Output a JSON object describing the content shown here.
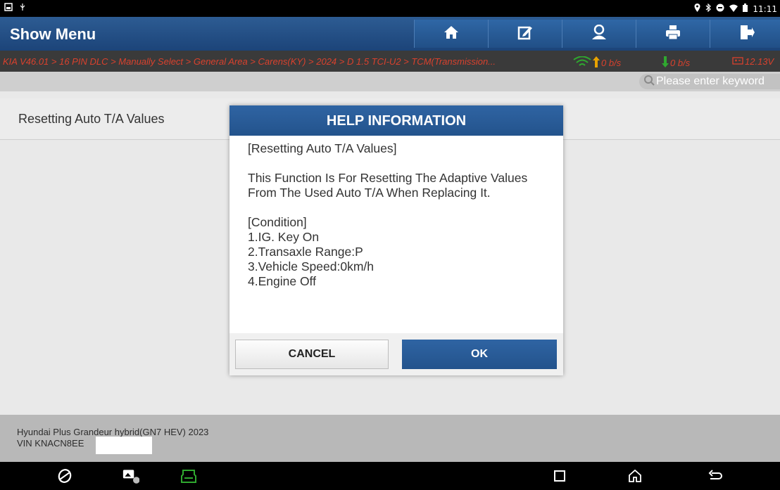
{
  "statusbar": {
    "left_icons": [
      "screenshot-icon",
      "usb-icon"
    ],
    "right_icons": [
      "location-icon",
      "bluetooth-icon",
      "dnd-icon",
      "wifi-icon",
      "battery-icon"
    ],
    "time": "11:11"
  },
  "header": {
    "title": "Show Menu",
    "buttons": [
      "home-icon",
      "edit-report-icon",
      "user-icon",
      "print-icon",
      "exit-icon"
    ]
  },
  "breadcrumb": {
    "path": "KIA V46.01 > 16 PIN DLC > Manually Select > General Area > Carens(KY) > 2024 > D 1.5 TCI-U2 > TCM(Transmission...",
    "upload": "0 b/s",
    "download": "0 b/s",
    "voltage": "12.13V"
  },
  "search": {
    "placeholder": "Please enter keyword"
  },
  "main": {
    "row_label": "Resetting Auto T/A Values"
  },
  "footer": {
    "vehicle": "Hyundai Plus Grandeur hybrid(GN7 HEV) 2023",
    "vin_prefix": "VIN KNACN8EE"
  },
  "dialog": {
    "title": "HELP INFORMATION",
    "lines": [
      "[Resetting Auto T/A Values]",
      "This Function Is For Resetting The Adaptive Values From The Used Auto T/A When Replacing It.",
      "[Condition]",
      "1.IG. Key On",
      "2.Transaxle Range:P",
      "3.Vehicle Speed:0km/h",
      "4.Engine Off"
    ],
    "cancel_label": "CANCEL",
    "ok_label": "OK"
  },
  "colors": {
    "header_blue": "#23538c",
    "breadcrumb_red": "#d9412d",
    "status_green": "#2fa82f"
  }
}
